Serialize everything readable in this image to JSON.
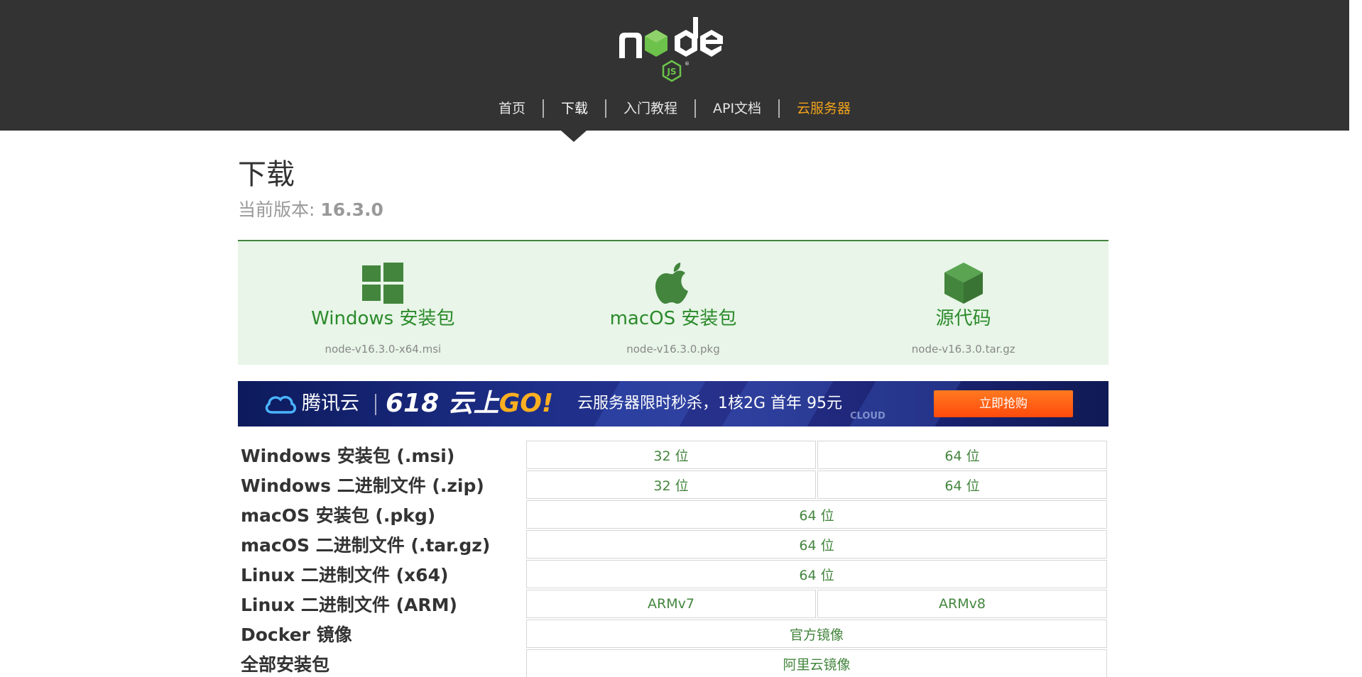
{
  "brand": {
    "logo_word": "node",
    "logo_badge": "JS"
  },
  "nav": {
    "items": [
      {
        "label": "首页"
      },
      {
        "label": "下载"
      },
      {
        "label": "入门教程"
      },
      {
        "label": "API文档"
      },
      {
        "label": "云服务器"
      }
    ],
    "active_index": 1,
    "highlight_index": 4,
    "highlight_color": "#f0a21c"
  },
  "page": {
    "title": "下载",
    "version_label": "当前版本: ",
    "version": "16.3.0"
  },
  "downloads": [
    {
      "icon": "windows-icon",
      "title": "Windows 安装包",
      "file": "node-v16.3.0-x64.msi"
    },
    {
      "icon": "apple-icon",
      "title": "macOS 安装包",
      "file": "node-v16.3.0.pkg"
    },
    {
      "icon": "cube-icon",
      "title": "源代码",
      "file": "node-v16.3.0.tar.gz"
    }
  ],
  "banner": {
    "brand": "腾讯云",
    "promo_number": "618 云上",
    "promo_go": "GO!",
    "offer": "云服务器限时秒杀，1核2G 首年 95元",
    "watermark": "CLOUD",
    "button": "立即抢购"
  },
  "table": {
    "rows": [
      {
        "label": "Windows 安装包 (.msi)",
        "cells": [
          "32 位",
          "64 位"
        ]
      },
      {
        "label": "Windows 二进制文件 (.zip)",
        "cells": [
          "32 位",
          "64 位"
        ]
      },
      {
        "label": "macOS 安装包 (.pkg)",
        "cells": [
          "64 位"
        ]
      },
      {
        "label": "macOS 二进制文件 (.tar.gz)",
        "cells": [
          "64 位"
        ]
      },
      {
        "label": "Linux 二进制文件 (x64)",
        "cells": [
          "64 位"
        ]
      },
      {
        "label": "Linux 二进制文件 (ARM)",
        "cells": [
          "ARMv7",
          "ARMv8"
        ]
      },
      {
        "label": "Docker 镜像",
        "cells": [
          "官方镜像"
        ]
      },
      {
        "label": "全部安装包",
        "cells": [
          "阿里云镜像"
        ]
      }
    ]
  },
  "colors": {
    "header_bg": "#333333",
    "accent_green": "#43853d",
    "panel_bg": "#e8f5e8",
    "nav_highlight": "#f0a21c"
  }
}
